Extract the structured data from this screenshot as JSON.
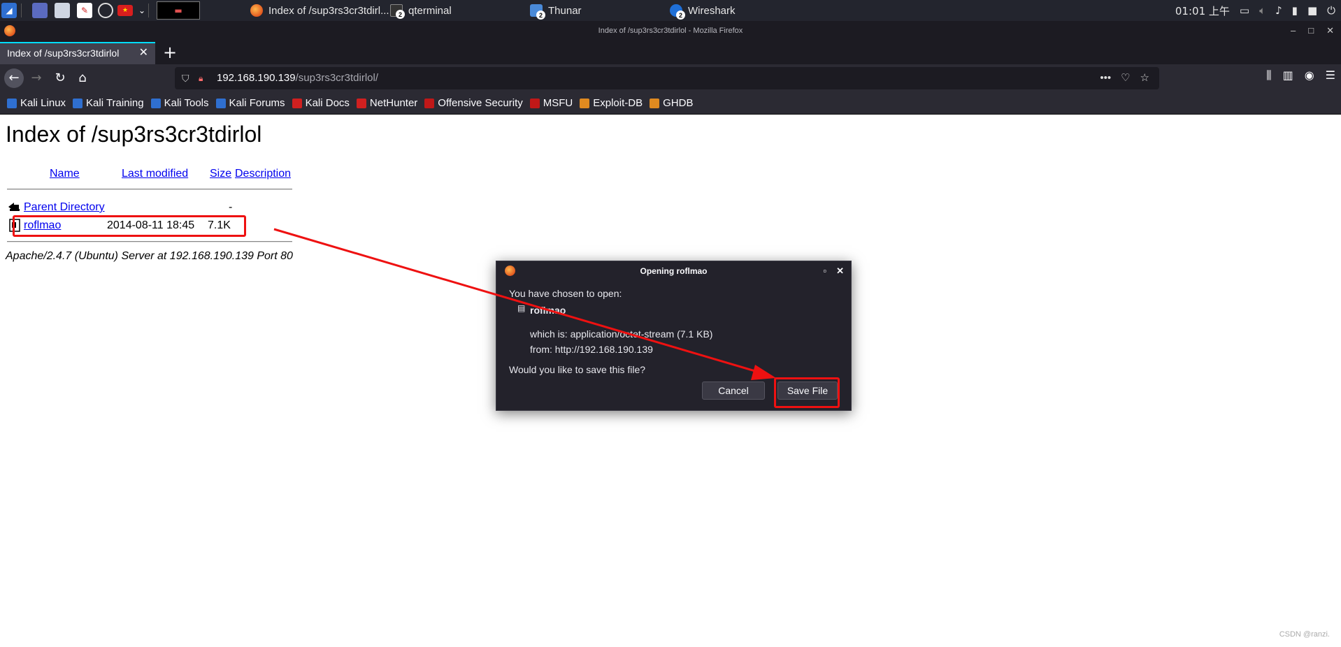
{
  "taskbar": {
    "tasks": [
      {
        "label": "Index of /sup3rs3cr3tdirl...",
        "badge": ""
      },
      {
        "label": "qterminal",
        "badge": "2"
      },
      {
        "label": "Thunar",
        "badge": "2"
      },
      {
        "label": "Wireshark",
        "badge": "2"
      }
    ],
    "clock": "01:01 上午"
  },
  "window": {
    "title": "Index of /sup3rs3cr3tdirlol - Mozilla Firefox"
  },
  "tab": {
    "label": "Index of /sup3rs3cr3tdirlol",
    "close": "✕",
    "new_tab": "+"
  },
  "urlbar": {
    "host": "192.168.190.139",
    "path": "/sup3rs3cr3tdirlol/"
  },
  "bookmarks": [
    {
      "label": "Kali Linux",
      "color": "#2f6fd0"
    },
    {
      "label": "Kali Training",
      "color": "#2f6fd0"
    },
    {
      "label": "Kali Tools",
      "color": "#2f6fd0"
    },
    {
      "label": "Kali Forums",
      "color": "#2f6fd0"
    },
    {
      "label": "Kali Docs",
      "color": "#d02020"
    },
    {
      "label": "NetHunter",
      "color": "#d02020"
    },
    {
      "label": "Offensive Security",
      "color": "#c01818"
    },
    {
      "label": "MSFU",
      "color": "#c01818"
    },
    {
      "label": "Exploit-DB",
      "color": "#e08a20"
    },
    {
      "label": "GHDB",
      "color": "#e08a20"
    }
  ],
  "page": {
    "heading": "Index of /sup3rs3cr3tdirlol",
    "columns": {
      "name": "Name",
      "last_modified": "Last modified",
      "size": "Size",
      "description": "Description"
    },
    "rows": [
      {
        "name": "Parent Directory",
        "date": "",
        "size": "-"
      },
      {
        "name": "roflmao",
        "date": "2014-08-11 18:45",
        "size": "7.1K"
      }
    ],
    "footer": "Apache/2.4.7 (Ubuntu) Server at 192.168.190.139 Port 80",
    "watermark": "CSDN @ranzi."
  },
  "dialog": {
    "title": "Opening roflmao",
    "chosen": "You have chosen to open:",
    "filename": "roflmao",
    "which_is": "which is: application/octet-stream (7.1 KB)",
    "from": "from: http://192.168.190.139",
    "question": "Would you like to save this file?",
    "cancel": "Cancel",
    "save": "Save File"
  },
  "colors": {
    "annotation": "#ee1111",
    "accent": "#00ddff",
    "link": "#0000ee"
  }
}
